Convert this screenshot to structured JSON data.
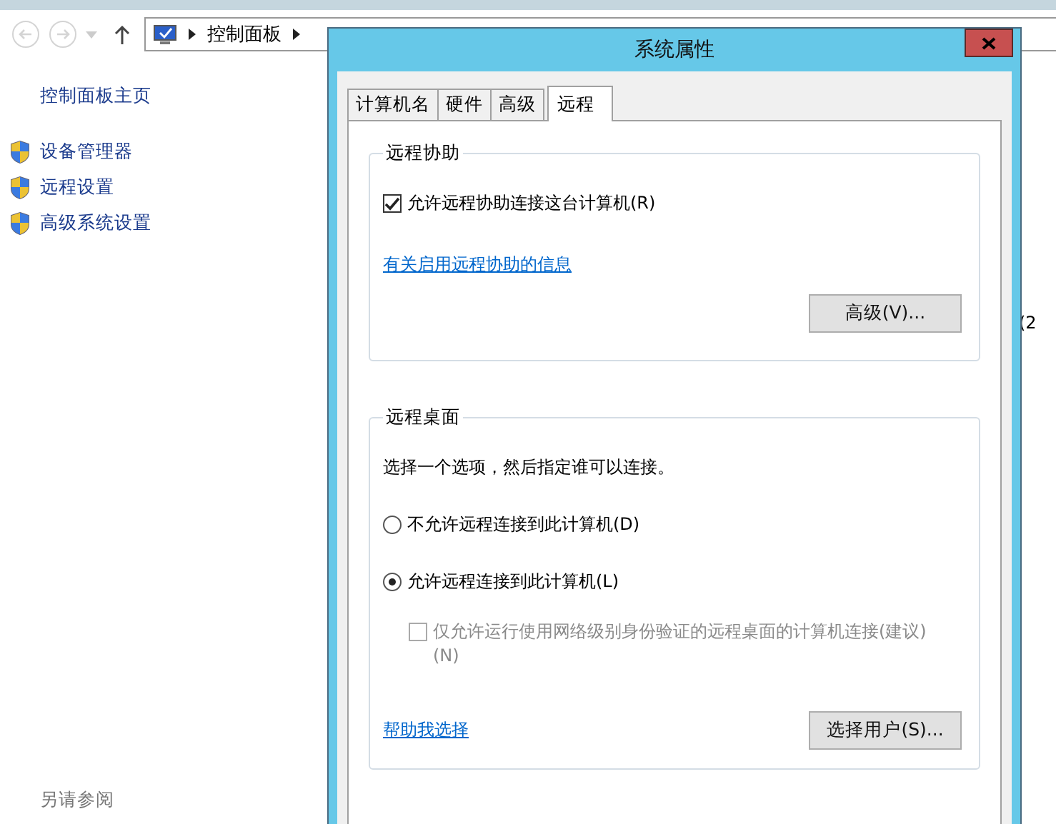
{
  "explorer": {
    "breadcrumb": "控制面板",
    "sidebar": {
      "home_link": "控制面板主页",
      "items": [
        "设备管理器",
        "远程设置",
        "高级系统设置"
      ],
      "see_also": "另请参阅"
    },
    "content_fragments": [
      {
        "text": "(2",
        "kind": "right"
      }
    ]
  },
  "dialog": {
    "title": "系统属性",
    "tabs": [
      {
        "label": "计算机名",
        "selected": false
      },
      {
        "label": "硬件",
        "selected": false
      },
      {
        "label": "高级",
        "selected": false
      },
      {
        "label": "远程",
        "selected": true
      }
    ],
    "remote_assistance": {
      "title": "远程协助",
      "allow": {
        "label": "允许远程协助连接这台计算机(R)",
        "checked": true
      },
      "info_link": "有关启用远程协助的信息",
      "advanced_button": "高级(V)..."
    },
    "remote_desktop": {
      "title": "远程桌面",
      "instruction": "选择一个选项，然后指定谁可以连接。",
      "options": [
        {
          "label": "不允许远程连接到此计算机(D)",
          "selected": false
        },
        {
          "label": "允许远程连接到此计算机(L)",
          "selected": true
        }
      ],
      "nla": {
        "label": "仅允许运行使用网络级别身份验证的远程桌面的计算机连接(建议)(N)",
        "checked": false,
        "disabled": true
      },
      "help_link": "帮助我选择",
      "select_users_button": "选择用户(S)..."
    }
  }
}
